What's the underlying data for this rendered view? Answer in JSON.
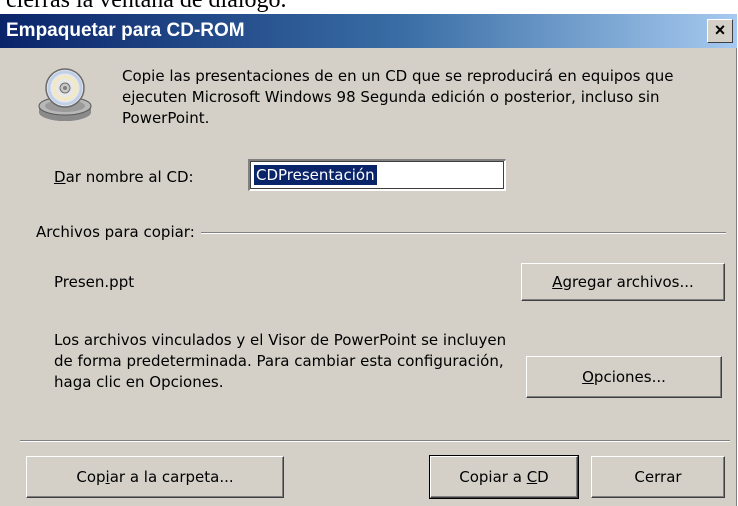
{
  "doc_context": {
    "partial_text": "cierras la ventana de diálogo."
  },
  "dialog": {
    "title": "Empaquetar para CD-ROM",
    "close_glyph": "×",
    "icon": "cd-drive-icon",
    "description": "Copie las presentaciones de en un CD que se reproducirá en equipos que ejecuten Microsoft Windows 98 Segunda edición o posterior, incluso sin PowerPoint.",
    "cd_name": {
      "label_accel": "D",
      "label_rest": "ar nombre al CD:",
      "value": "CDPresentación"
    },
    "files_group": {
      "label": "Archivos para copiar:",
      "files": [
        "Presen.ppt"
      ],
      "add_button": {
        "accel": "A",
        "rest": "gregar archivos..."
      },
      "note": "Los archivos vinculados y el Visor de PowerPoint se incluyen de forma predeterminada. Para cambiar esta configuración, haga clic en Opciones.",
      "options_button": {
        "accel": "O",
        "rest": "pciones..."
      }
    },
    "buttons": {
      "copy_folder": {
        "pre": "Cop",
        "accel": "i",
        "post": "ar a la carpeta..."
      },
      "copy_cd": {
        "pre": "Copiar a ",
        "accel": "C",
        "post": "D"
      },
      "close": "Cerrar"
    }
  }
}
